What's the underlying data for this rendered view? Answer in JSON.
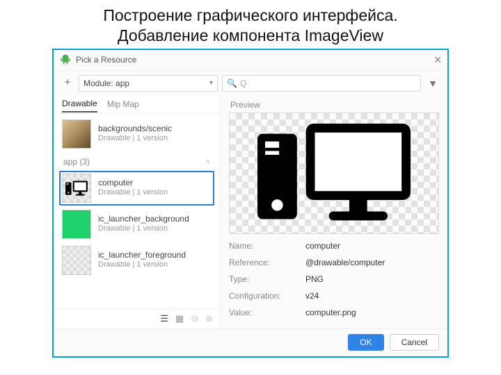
{
  "slide": {
    "title_line1": "Построение графического интерфейса.",
    "title_line2": "Добавление компонента ImageView"
  },
  "dialog": {
    "title": "Pick a Resource",
    "module_label": "Module: app",
    "search_placeholder": "Q·",
    "tabs": {
      "drawable": "Drawable",
      "mipmap": "Mip Map"
    },
    "preview_label": "Preview",
    "ok": "OK",
    "cancel": "Cancel"
  },
  "sections": {
    "app_header": "app (3)"
  },
  "items": {
    "scenic": {
      "name": "backgrounds/scenic",
      "sub": "Drawable  |  1 version"
    },
    "computer": {
      "name": "computer",
      "sub": "Drawable  |  1 version"
    },
    "icbg": {
      "name": "ic_launcher_background",
      "sub": "Drawable  |  1 version"
    },
    "icfg": {
      "name": "ic_launcher_foreground",
      "sub": "Drawable  |  1 version"
    }
  },
  "details": {
    "name": {
      "k": "Name:",
      "v": "computer"
    },
    "ref": {
      "k": "Reference:",
      "v": "@drawable/computer"
    },
    "type": {
      "k": "Type:",
      "v": "PNG"
    },
    "config": {
      "k": "Configuration:",
      "v": "v24"
    },
    "value": {
      "k": "Value:",
      "v": "computer.png"
    }
  }
}
